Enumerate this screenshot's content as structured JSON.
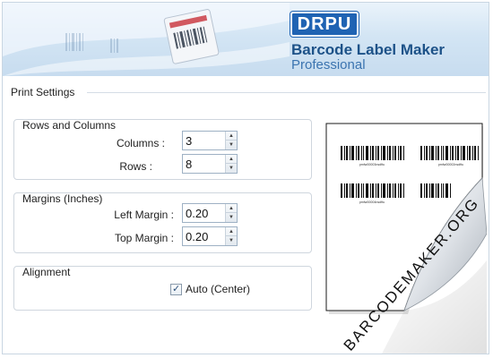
{
  "brand": {
    "logo_text": "DRPU",
    "title": "Barcode Label Maker",
    "edition": "Professional"
  },
  "print_settings": {
    "title": "Print Settings",
    "rows_and_columns": {
      "legend": "Rows and Columns",
      "columns_label": "Columns :",
      "columns_value": "3",
      "rows_label": "Rows :",
      "rows_value": "8"
    },
    "margins": {
      "legend": "Margins (Inches)",
      "left_label": "Left Margin :",
      "left_value": "0.20",
      "top_label": "Top Margin :",
      "top_value": "0.20"
    },
    "alignment": {
      "legend": "Alignment",
      "auto_center_label": "Auto (Center)",
      "auto_center_checked": true
    }
  },
  "preview": {
    "barcode_captions": [
      "pmfw00003nsdftu",
      "pmfw00002nsdftu",
      "pmfw00004nsdftu"
    ]
  },
  "watermark": "BARCODEMAKER.ORG",
  "icons": {
    "spin_up": "▲",
    "spin_down": "▼",
    "check": "✓"
  }
}
